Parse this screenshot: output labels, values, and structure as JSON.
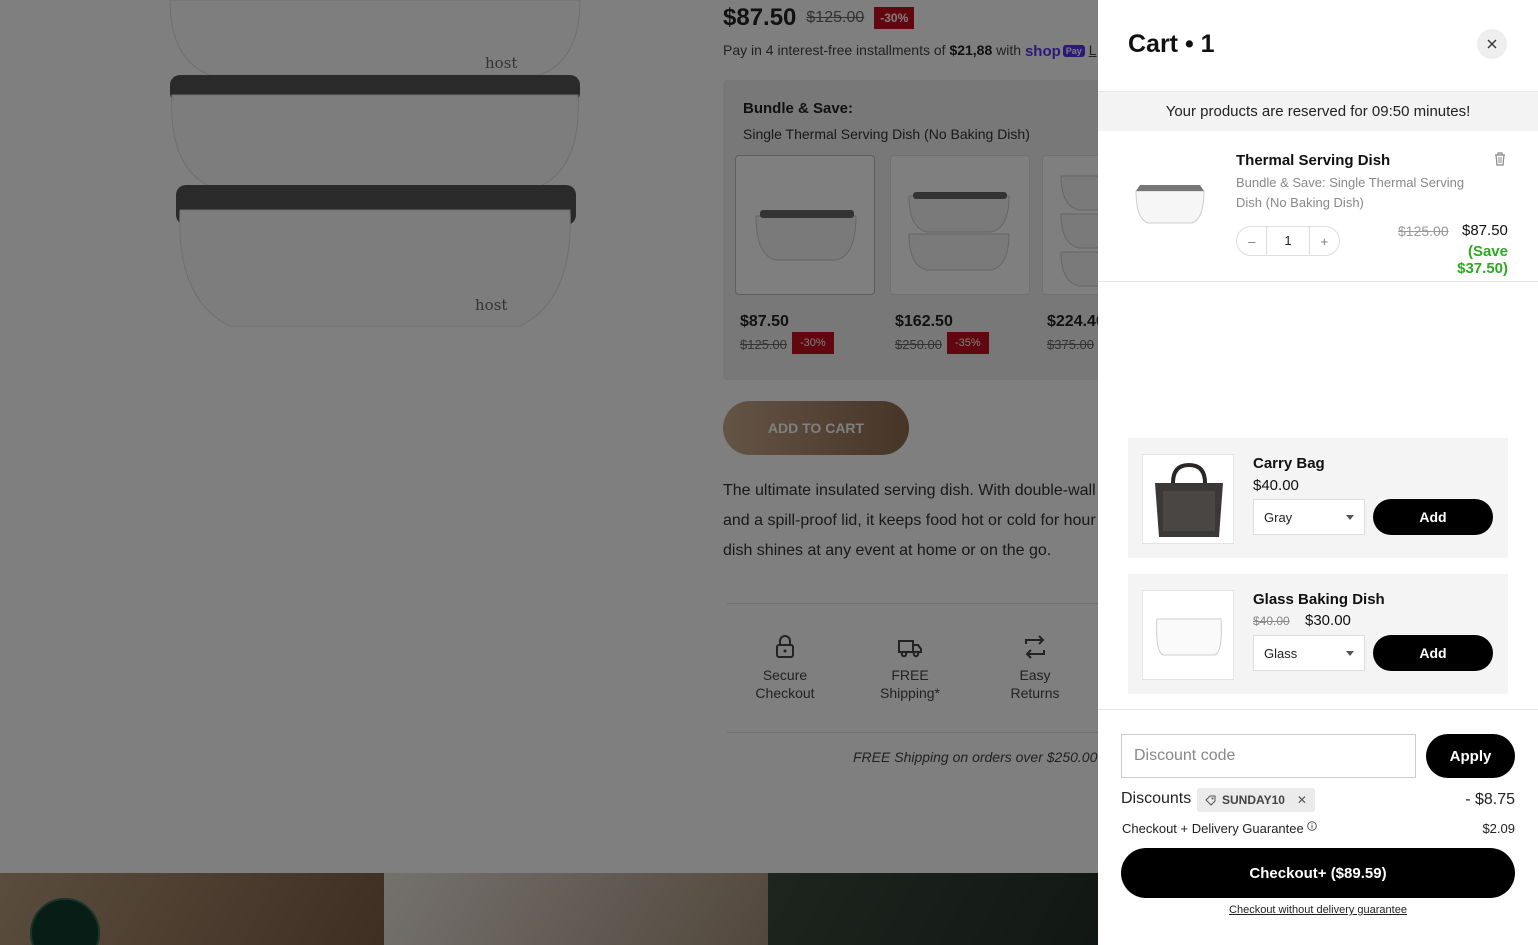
{
  "product": {
    "price": "$87.50",
    "compare_price": "$125.00",
    "discount_badge": "-30%",
    "installments_prefix": "Pay in 4 interest-free installments of",
    "installments_amount": "$21,88",
    "installments_with": "with",
    "shop_pay_label": "shop",
    "shop_pay_badge": "Pay",
    "learn_more": "L",
    "bundle_title": "Bundle & Save:",
    "bundle_selected": "Single Thermal Serving Dish (No Baking Dish)",
    "bundle_options": [
      {
        "price": "$87.50",
        "compare": "$125.00",
        "badge": "-30%"
      },
      {
        "price": "$162.50",
        "compare": "$250.00",
        "badge": "-35%"
      },
      {
        "price": "$224.40",
        "compare": "$375.00",
        "badge": ""
      }
    ],
    "add_to_cart": "ADD TO CART",
    "description_lines": [
      "The ultimate insulated serving dish. With double-wall",
      "and a spill-proof lid, it keeps food hot or cold for hour",
      "dish shines at any event at home or on the go."
    ],
    "trust_badges": [
      {
        "line1": "Secure",
        "line2": "Checkout",
        "icon": "lock-icon"
      },
      {
        "line1": "FREE",
        "line2": "Shipping*",
        "icon": "truck-icon"
      },
      {
        "line1": "Easy",
        "line2": "Returns",
        "icon": "return-arrows-icon"
      }
    ],
    "shipping_note": "FREE Shipping on orders over $250.00"
  },
  "cart": {
    "title": "Cart • 1",
    "reservation": "Your products are reserved for 09:50 minutes!",
    "line_item": {
      "name": "Thermal Serving Dish",
      "variant": "Bundle & Save: Single Thermal Serving Dish (No Baking Dish)",
      "quantity": "1",
      "qty_minus": "–",
      "qty_plus": "+",
      "compare_price": "$125.00",
      "price": "$87.50",
      "savings": "(Save $37.50)"
    },
    "upsells": [
      {
        "name": "Carry Bag",
        "price": "$40.00",
        "compare": "",
        "option": "Gray",
        "add_label": "Add"
      },
      {
        "name": "Glass Baking Dish",
        "price": "$30.00",
        "compare": "$40.00",
        "option": "Glass",
        "add_label": "Add"
      }
    ],
    "discount_placeholder": "Discount code",
    "apply_label": "Apply",
    "discounts_label": "Discounts",
    "discount_code": "SUNDAY10",
    "discount_amount": "- $8.75",
    "guarantee_label": "Checkout + Delivery Guarantee",
    "guarantee_amount": "$2.09",
    "checkout_label": "Checkout+ ($89.59)",
    "no_guarantee_label": "Checkout without delivery guarantee"
  },
  "colors": {
    "accent_black": "#000000",
    "sale_red": "#c40d1e",
    "savings_green": "#2fa824",
    "overlay": "rgba(0,0,0,0.5)"
  }
}
